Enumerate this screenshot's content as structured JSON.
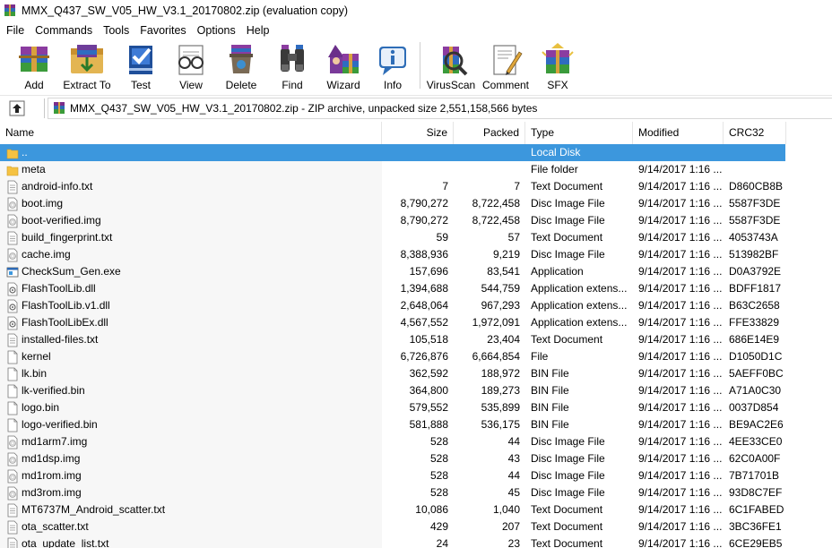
{
  "window": {
    "title": "MMX_Q437_SW_V05_HW_V3.1_20170802.zip (evaluation copy)"
  },
  "menu": [
    "File",
    "Commands",
    "Tools",
    "Favorites",
    "Options",
    "Help"
  ],
  "toolbar": {
    "buttons": [
      {
        "label": "Add",
        "icon": "add-archive-icon"
      },
      {
        "label": "Extract To",
        "icon": "extract-to-icon"
      },
      {
        "label": "Test",
        "icon": "test-icon"
      },
      {
        "label": "View",
        "icon": "view-icon"
      },
      {
        "label": "Delete",
        "icon": "delete-icon"
      },
      {
        "label": "Find",
        "icon": "find-icon"
      },
      {
        "label": "Wizard",
        "icon": "wizard-icon"
      },
      {
        "label": "Info",
        "icon": "info-icon"
      },
      {
        "label": "VirusScan",
        "icon": "virusscan-icon"
      },
      {
        "label": "Comment",
        "icon": "comment-icon"
      },
      {
        "label": "SFX",
        "icon": "sfx-icon"
      }
    ]
  },
  "path": {
    "text": "MMX_Q437_SW_V05_HW_V3.1_20170802.zip - ZIP archive, unpacked size 2,551,158,566 bytes"
  },
  "columns": {
    "name": "Name",
    "size": "Size",
    "packed": "Packed",
    "type": "Type",
    "modified": "Modified",
    "crc": "CRC32",
    "sort_indicator": "^"
  },
  "colors": {
    "selection": "#3c97dd",
    "folder": "#f5c242"
  },
  "files": [
    {
      "name": "..",
      "size": "",
      "packed": "",
      "type": "Local Disk",
      "modified": "",
      "crc": "",
      "icon": "folder-up-icon",
      "selected": true
    },
    {
      "name": "meta",
      "size": "",
      "packed": "",
      "type": "File folder",
      "modified": "9/14/2017 1:16 ...",
      "crc": "",
      "icon": "folder-icon"
    },
    {
      "name": "android-info.txt",
      "size": "7",
      "packed": "7",
      "type": "Text Document",
      "modified": "9/14/2017 1:16 ...",
      "crc": "D860CB8B",
      "icon": "text-file-icon"
    },
    {
      "name": "boot.img",
      "size": "8,790,272",
      "packed": "8,722,458",
      "type": "Disc Image File",
      "modified": "9/14/2017 1:16 ...",
      "crc": "5587F3DE",
      "icon": "disc-image-icon"
    },
    {
      "name": "boot-verified.img",
      "size": "8,790,272",
      "packed": "8,722,458",
      "type": "Disc Image File",
      "modified": "9/14/2017 1:16 ...",
      "crc": "5587F3DE",
      "icon": "disc-image-icon"
    },
    {
      "name": "build_fingerprint.txt",
      "size": "59",
      "packed": "57",
      "type": "Text Document",
      "modified": "9/14/2017 1:16 ...",
      "crc": "4053743A",
      "icon": "text-file-icon"
    },
    {
      "name": "cache.img",
      "size": "8,388,936",
      "packed": "9,219",
      "type": "Disc Image File",
      "modified": "9/14/2017 1:16 ...",
      "crc": "513982BF",
      "icon": "disc-image-icon"
    },
    {
      "name": "CheckSum_Gen.exe",
      "size": "157,696",
      "packed": "83,541",
      "type": "Application",
      "modified": "9/14/2017 1:16 ...",
      "crc": "D0A3792E",
      "icon": "application-icon"
    },
    {
      "name": "FlashToolLib.dll",
      "size": "1,394,688",
      "packed": "544,759",
      "type": "Application extens...",
      "modified": "9/14/2017 1:16 ...",
      "crc": "BDFF1817",
      "icon": "dll-icon"
    },
    {
      "name": "FlashToolLib.v1.dll",
      "size": "2,648,064",
      "packed": "967,293",
      "type": "Application extens...",
      "modified": "9/14/2017 1:16 ...",
      "crc": "B63C2658",
      "icon": "dll-icon"
    },
    {
      "name": "FlashToolLibEx.dll",
      "size": "4,567,552",
      "packed": "1,972,091",
      "type": "Application extens...",
      "modified": "9/14/2017 1:16 ...",
      "crc": "FFE33829",
      "icon": "dll-icon"
    },
    {
      "name": "installed-files.txt",
      "size": "105,518",
      "packed": "23,404",
      "type": "Text Document",
      "modified": "9/14/2017 1:16 ...",
      "crc": "686E14E9",
      "icon": "text-file-icon"
    },
    {
      "name": "kernel",
      "size": "6,726,876",
      "packed": "6,664,854",
      "type": "File",
      "modified": "9/14/2017 1:16 ...",
      "crc": "D1050D1C",
      "icon": "blank-file-icon"
    },
    {
      "name": "lk.bin",
      "size": "362,592",
      "packed": "188,972",
      "type": "BIN File",
      "modified": "9/14/2017 1:16 ...",
      "crc": "5AEFF0BC",
      "icon": "blank-file-icon"
    },
    {
      "name": "lk-verified.bin",
      "size": "364,800",
      "packed": "189,273",
      "type": "BIN File",
      "modified": "9/14/2017 1:16 ...",
      "crc": "A71A0C30",
      "icon": "blank-file-icon"
    },
    {
      "name": "logo.bin",
      "size": "579,552",
      "packed": "535,899",
      "type": "BIN File",
      "modified": "9/14/2017 1:16 ...",
      "crc": "0037D854",
      "icon": "blank-file-icon"
    },
    {
      "name": "logo-verified.bin",
      "size": "581,888",
      "packed": "536,175",
      "type": "BIN File",
      "modified": "9/14/2017 1:16 ...",
      "crc": "BE9AC2E6",
      "icon": "blank-file-icon"
    },
    {
      "name": "md1arm7.img",
      "size": "528",
      "packed": "44",
      "type": "Disc Image File",
      "modified": "9/14/2017 1:16 ...",
      "crc": "4EE33CE0",
      "icon": "disc-image-icon"
    },
    {
      "name": "md1dsp.img",
      "size": "528",
      "packed": "43",
      "type": "Disc Image File",
      "modified": "9/14/2017 1:16 ...",
      "crc": "62C0A00F",
      "icon": "disc-image-icon"
    },
    {
      "name": "md1rom.img",
      "size": "528",
      "packed": "44",
      "type": "Disc Image File",
      "modified": "9/14/2017 1:16 ...",
      "crc": "7B71701B",
      "icon": "disc-image-icon"
    },
    {
      "name": "md3rom.img",
      "size": "528",
      "packed": "45",
      "type": "Disc Image File",
      "modified": "9/14/2017 1:16 ...",
      "crc": "93D8C7EF",
      "icon": "disc-image-icon"
    },
    {
      "name": "MT6737M_Android_scatter.txt",
      "size": "10,086",
      "packed": "1,040",
      "type": "Text Document",
      "modified": "9/14/2017 1:16 ...",
      "crc": "6C1FABED",
      "icon": "text-file-icon"
    },
    {
      "name": "ota_scatter.txt",
      "size": "429",
      "packed": "207",
      "type": "Text Document",
      "modified": "9/14/2017 1:16 ...",
      "crc": "3BC36FE1",
      "icon": "text-file-icon"
    },
    {
      "name": "ota_update_list.txt",
      "size": "24",
      "packed": "23",
      "type": "Text Document",
      "modified": "9/14/2017 1:16 ...",
      "crc": "6CE29EB5",
      "icon": "text-file-icon"
    }
  ]
}
